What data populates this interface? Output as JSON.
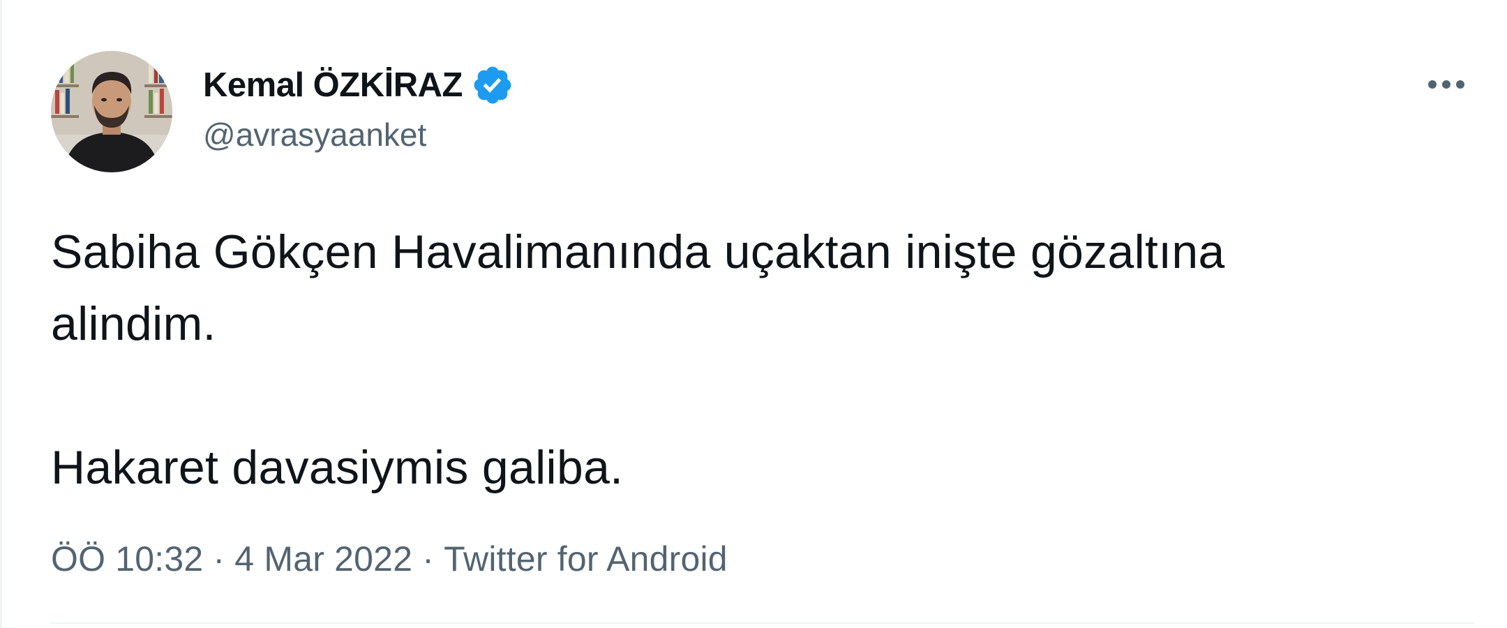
{
  "author": {
    "display_name": "Kemal ÖZKİRAZ",
    "handle": "@avrasyaanket",
    "verified": true,
    "verified_color": "#1d9bf0",
    "avatar_icon": "person-avatar"
  },
  "more_icon": "ellipsis-icon",
  "tweet": {
    "lines": [
      "Sabiha Gökçen Havalimanında uçaktan inişte gözaltına",
      "alindim.",
      "Hakaret davasiymis galiba."
    ]
  },
  "meta": {
    "time": "ÖÖ 10:32",
    "separator": "·",
    "date": "4 Mar 2022",
    "source": "Twitter for Android"
  },
  "colors": {
    "text": "#0f1419",
    "secondary": "#536471",
    "border": "#eff3f4"
  }
}
